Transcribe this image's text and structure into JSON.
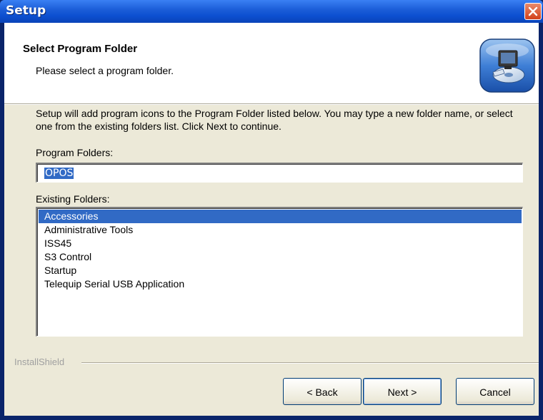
{
  "window": {
    "title": "Setup"
  },
  "header": {
    "title": "Select Program Folder",
    "subtitle": "Please select a program folder."
  },
  "main": {
    "description": "Setup will add program icons to the Program Folder listed below.  You may type a new folder name, or select one from the existing folders list.  Click Next to continue.",
    "program_folders_label": "Program Folders:",
    "program_folder_value": "OPOS",
    "existing_folders_label": "Existing Folders:",
    "existing_folders": [
      {
        "label": "Accessories",
        "selected": true
      },
      {
        "label": "Administrative Tools",
        "selected": false
      },
      {
        "label": "ISS45",
        "selected": false
      },
      {
        "label": "S3 Control",
        "selected": false
      },
      {
        "label": "Startup",
        "selected": false
      },
      {
        "label": "Telequip Serial USB Application",
        "selected": false
      }
    ]
  },
  "footer": {
    "brand_label": "InstallShield",
    "back_label": "< Back",
    "next_label": "Next >",
    "cancel_label": "Cancel"
  },
  "icons": {
    "close": "close-icon",
    "header": "computer-setup-icon"
  },
  "colors": {
    "titlebar": "#0c4fd0",
    "selection": "#316ac5",
    "close_button": "#d3411b",
    "dialog_background": "#ece9d8"
  }
}
